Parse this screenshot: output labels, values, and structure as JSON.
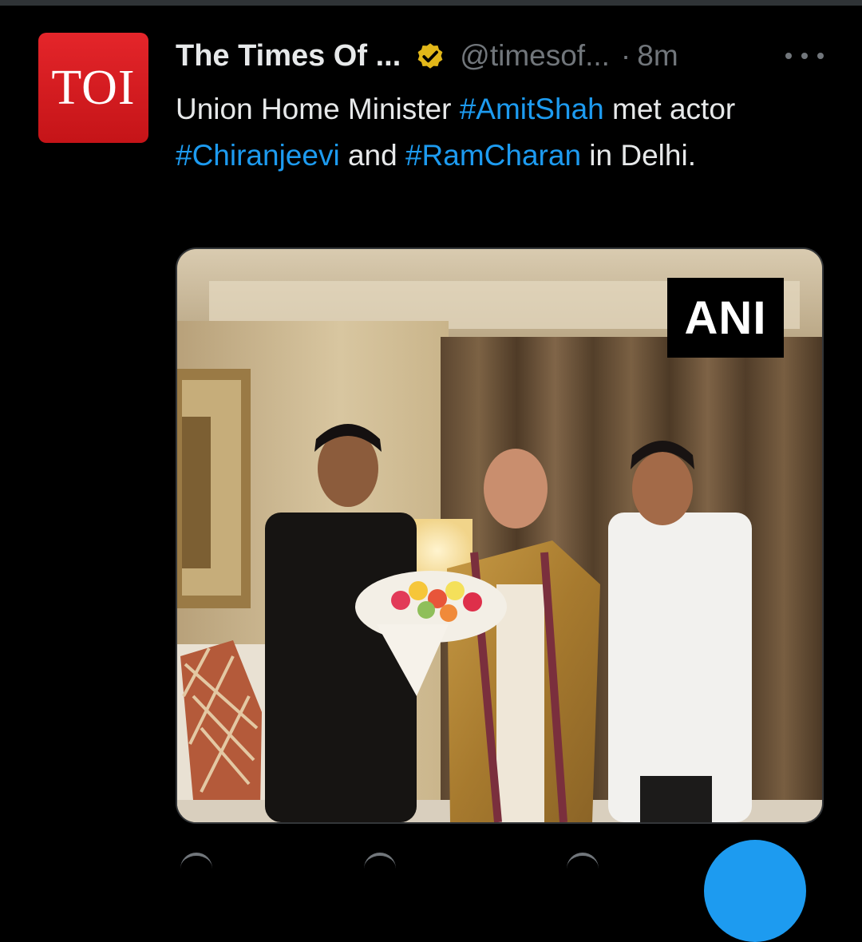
{
  "tweet": {
    "avatar_text": "TOI",
    "display_name": "The Times Of ...",
    "handle": "@timesof...",
    "separator": "·",
    "time": "8m",
    "text_parts": [
      {
        "text": "Union Home Minister ",
        "type": "plain"
      },
      {
        "text": "#AmitShah",
        "type": "hashtag"
      },
      {
        "text": " met actor ",
        "type": "plain"
      },
      {
        "text": "#Chiranjeevi",
        "type": "hashtag"
      },
      {
        "text": " and ",
        "type": "plain"
      },
      {
        "text": "#RamCharan",
        "type": "hashtag"
      },
      {
        "text": " in Delhi.",
        "type": "plain"
      }
    ],
    "media": {
      "watermark": "ANI"
    }
  },
  "icons": {
    "verified": "verified-badge-icon",
    "more": "more-options-icon",
    "reply": "reply-icon",
    "retweet": "retweet-icon",
    "like": "like-icon",
    "compose": "compose-fab-icon"
  },
  "colors": {
    "background": "#000000",
    "text": "#e7e9ea",
    "secondary": "#71767b",
    "link": "#1d9bf0",
    "brand_red": "#d71920",
    "verified_gold": "#e2b719"
  }
}
